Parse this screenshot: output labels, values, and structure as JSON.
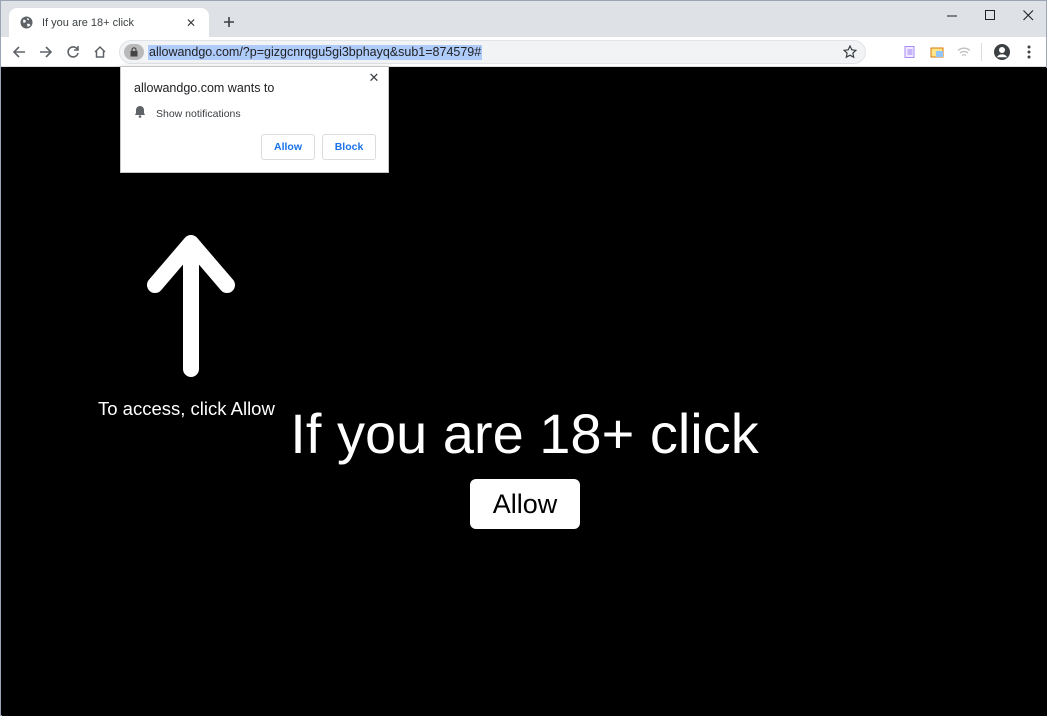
{
  "tab": {
    "title": "If you are 18+ click",
    "favicon": "globe-icon"
  },
  "toolbar": {
    "url": "allowandgo.com/?p=gizgcnrqgu5gi3bphayq&sub1=874579#"
  },
  "popup": {
    "title": "allowandgo.com wants to",
    "permission": "Show notifications",
    "allow_label": "Allow",
    "block_label": "Block"
  },
  "page": {
    "access_text": "To access, click Allow",
    "headline": "If you are 18+ click",
    "allow_label": "Allow"
  },
  "colors": {
    "page_bg": "#000000",
    "link_blue": "#1a73e8",
    "url_highlight": "#aecbfa"
  }
}
